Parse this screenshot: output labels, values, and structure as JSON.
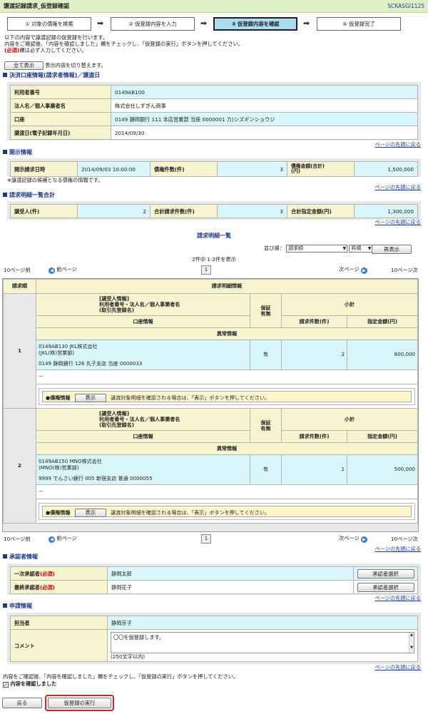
{
  "header": {
    "title": "譲渡記録請求_仮登録確認",
    "screen_id": "SCKASGI1125"
  },
  "steps": [
    "① 対象の債権を検索",
    "② 仮登録内容を入力",
    "③ 仮登録内容を確認",
    "④ 仮登録完了"
  ],
  "intro": {
    "line1": "以下の内容で譲渡記録の仮登録を行います。",
    "line2": "内容をご確認後、「内容を確認しました」欄をチェックし、「仮登録の実行」ボタンを押してください。",
    "req_badge": "(必須)",
    "line3": "欄は必ず入力してください。"
  },
  "toggle": {
    "button": "全て表示",
    "text": "表示内容を切り替えます。"
  },
  "top_link": "ページの先頭に戻る",
  "settlement": {
    "title": "決済口座情報(請求者情報)／譲渡日",
    "rows": [
      {
        "label": "利用者番号",
        "value": "0149AB100"
      },
      {
        "label": "法人名／個人事業者名",
        "value": "株式会社しずぎん商事"
      },
      {
        "label": "口座",
        "value": "0149 静岡銀行 111 本店営業部 当座 0000001 カ)シズギンショウジ"
      },
      {
        "label": "譲渡日(電子記録年月日)",
        "value": "2014/09/30"
      }
    ]
  },
  "disclosure": {
    "title": "開示情報",
    "l1": "開示請求日時",
    "v1": "2014/09/03 10:00:00",
    "l2": "債権件数(件)",
    "v2": "3",
    "l3": "債権金額(合計)\n(円)",
    "v3": "1,500,000",
    "note": "※譲渡記録の候補となる債権の情報です。"
  },
  "summary": {
    "title": "請求明細一覧合計",
    "l1": "譲受人(件)",
    "v1": "2",
    "l2": "合計請求件数(件)",
    "v2": "3",
    "l3": "合計指定金額(円)",
    "v3": "1,300,000"
  },
  "detail": {
    "title": "請求明細一覧",
    "sort": {
      "label": "並び順：",
      "order_value": "請求順",
      "dir_value": "昇順",
      "redisplay": "再表示"
    },
    "count_text": "2件中 1-2件を表示",
    "pager": {
      "prev10": "10ページ前",
      "prev": "前ページ",
      "page": "1",
      "next": "次ページ",
      "next10": "10ページ次"
    },
    "headers": {
      "no": "請求順",
      "info": "請求明細情報",
      "party": "[譲受人情報]\n利用者番号・法人名／個人事業者名\n(取引先登録名)",
      "guarantee": "保証\n有無",
      "subtotal": "小計",
      "account": "口座情報",
      "count": "請求件数(件)",
      "amount": "指定金額(円)",
      "abnormal": "異常情報"
    },
    "bond_label": "●債権情報",
    "bond_button": "表示",
    "bond_text": "譲渡対象明細を確認される場合は、「表示」ボタンを押してください。",
    "rows": [
      {
        "no": "1",
        "party1": "0149AB130 JKL株式会社",
        "party2": "(JKL(株)営業部)",
        "account": "0149 静岡銀行 126 丸子支店 当座 0000033",
        "guarantee": "有",
        "count": "2",
        "amount": "800,000",
        "abnormal": "－"
      },
      {
        "no": "2",
        "party1": "0149AB150 MNO株式会社",
        "party2": "(MNO(株)営業部)",
        "account": "9999 でんさい銀行 005 新宿支店 普通 0000055",
        "guarantee": "有",
        "count": "1",
        "amount": "500,000",
        "abnormal": "－"
      }
    ]
  },
  "approver": {
    "title": "承認者情報",
    "rows": [
      {
        "label": "一次承認者",
        "req": "(必須)",
        "value": "静岡太郎",
        "button": "承認者選択"
      },
      {
        "label": "最終承認者",
        "req": "(必須)",
        "value": "静岡花子",
        "button": "承認者選択"
      }
    ]
  },
  "application": {
    "title": "申請情報",
    "l1": "担当者",
    "v1": "静岡京子",
    "l2": "コメント",
    "comment": "〇〇を仮登録します。",
    "limit": "(250文字以内)"
  },
  "confirm": {
    "text": "内容をご確認後、「内容を確認しました」欄をチェックし、「仮登録の実行」ボタンを押してください。",
    "checkbox": "内容を確認しました",
    "back": "戻る",
    "execute": "仮登録の実行"
  }
}
